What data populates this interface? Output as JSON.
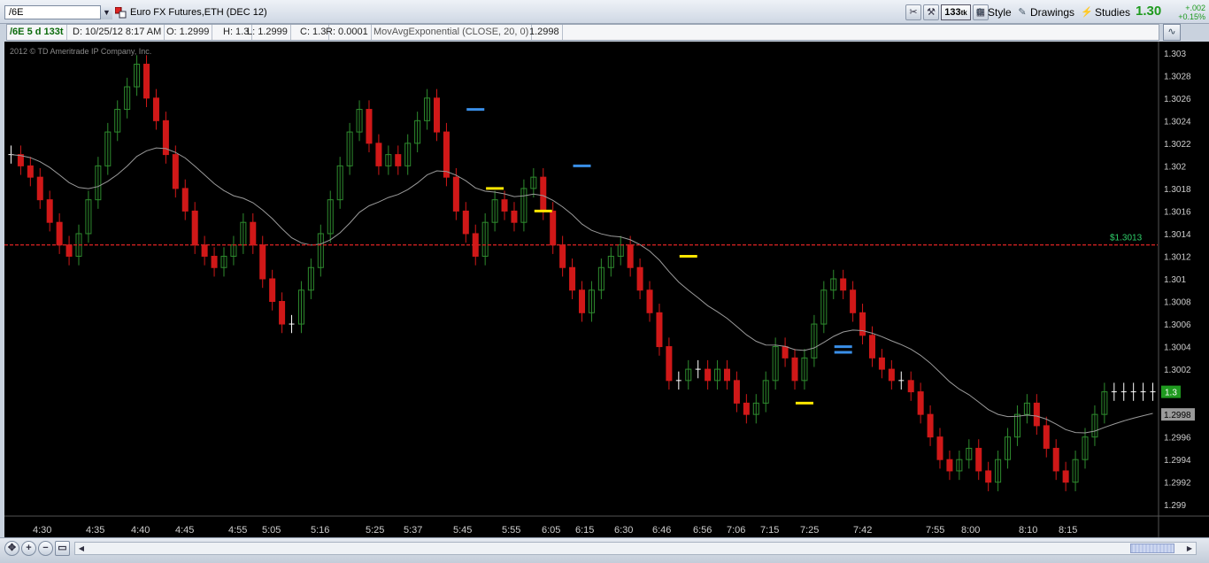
{
  "toolbar": {
    "symbol": "/6E",
    "instrument": "Euro FX Futures,ETH (DEC 12)",
    "tick_aggregation": "133",
    "tick_suffix": "tk",
    "style_label": "Style",
    "drawings_label": "Drawings",
    "studies_label": "Studies",
    "last_price": "1.30",
    "net_change": "+.002",
    "net_change_pct": "+0.15%"
  },
  "infobar": {
    "symbol_period": "/6E 5 d 133t",
    "date": "D: 10/25/12 8:17 AM",
    "open": "O: 1.2999",
    "high": "H: 1.3",
    "low": "L: 1.2999",
    "close": "C: 1.3",
    "range": "R: 0.0001",
    "study": "MovAvgExponential (CLOSE, 20, 0)",
    "study_value": "1.2998"
  },
  "chart": {
    "copyright": "2012 © TD Ameritrade IP Company, Inc.",
    "colors": {
      "background": "#000000",
      "up": "#2e8b2e",
      "down": "#d01818",
      "flat": "#ffffff",
      "ema": "#9a9a9a",
      "hline": "#cc2020",
      "hline_label": "#2fd06a",
      "price_marker": "#1f9a1f",
      "ema_marker": "#9a9a9a",
      "axis_text": "#cccccc"
    }
  },
  "chart_data": {
    "type": "candlestick",
    "ylim": [
      1.2989,
      1.3031
    ],
    "y_ticks": [
      "1.303",
      "1.3028",
      "1.3026",
      "1.3024",
      "1.3022",
      "1.302",
      "1.3018",
      "1.3016",
      "1.3014",
      "1.3012",
      "1.301",
      "1.3008",
      "1.3006",
      "1.3004",
      "1.3002",
      "1.3",
      "1.2998",
      "1.2996",
      "1.2994",
      "1.2992",
      "1.299"
    ],
    "x_labels": [
      "4:30",
      "4:35",
      "4:40",
      "4:45",
      "4:55",
      "5:05",
      "5:16",
      "5:25",
      "5:37",
      "5:45",
      "5:55",
      "6:05",
      "6:15",
      "6:30",
      "6:46",
      "6:56",
      "7:06",
      "7:15",
      "7:25",
      "7:42",
      "7:55",
      "8:00",
      "8:10",
      "8:15"
    ],
    "closes": [
      1.3021,
      1.302,
      1.3019,
      1.3017,
      1.3015,
      1.3013,
      1.3012,
      1.3014,
      1.3017,
      1.302,
      1.3023,
      1.3025,
      1.3027,
      1.3029,
      1.3026,
      1.3024,
      1.3021,
      1.3018,
      1.3016,
      1.3013,
      1.3012,
      1.3011,
      1.3012,
      1.3013,
      1.3015,
      1.3013,
      1.301,
      1.3008,
      1.3006,
      1.3006,
      1.3009,
      1.3011,
      1.3014,
      1.3017,
      1.302,
      1.3023,
      1.3025,
      1.3022,
      1.302,
      1.3021,
      1.302,
      1.3022,
      1.3024,
      1.3026,
      1.3023,
      1.3019,
      1.3016,
      1.3014,
      1.3012,
      1.3015,
      1.3017,
      1.3016,
      1.3015,
      1.3018,
      1.3019,
      1.3016,
      1.3013,
      1.3011,
      1.3009,
      1.3007,
      1.3009,
      1.3011,
      1.3012,
      1.3013,
      1.3011,
      1.3009,
      1.3007,
      1.3004,
      1.3001,
      1.3001,
      1.3002,
      1.3002,
      1.3001,
      1.3002,
      1.3001,
      1.2999,
      1.2998,
      1.2999,
      1.3001,
      1.3004,
      1.3003,
      1.3001,
      1.3003,
      1.3006,
      1.3009,
      1.301,
      1.3009,
      1.3007,
      1.3005,
      1.3003,
      1.3002,
      1.3001,
      1.3001,
      1.3,
      1.2998,
      1.2996,
      1.2994,
      1.2993,
      1.2994,
      1.2995,
      1.2993,
      1.2992,
      1.2994,
      1.2996,
      1.2998,
      1.2999,
      1.2997,
      1.2995,
      1.2993,
      1.2992,
      1.2994,
      1.2996,
      1.2998,
      1.3,
      1.3,
      1.3,
      1.3,
      1.3,
      1.3
    ],
    "ema_start": 1.3021,
    "ema_period": 20,
    "horizontal_line": {
      "value": 1.3013,
      "label": "$1.3013"
    },
    "price_label": "1.3",
    "price_value": 1.3,
    "ema_label": "1.2998",
    "ema_value": 1.2998,
    "trade_marks": [
      {
        "index": 48,
        "value": 1.3025,
        "color": "#3a8fe8"
      },
      {
        "index": 50,
        "value": 1.3018,
        "color": "#ffe600"
      },
      {
        "index": 55,
        "value": 1.3016,
        "color": "#ffe600"
      },
      {
        "index": 59,
        "value": 1.302,
        "color": "#3a8fe8"
      },
      {
        "index": 70,
        "value": 1.3012,
        "color": "#ffe600"
      },
      {
        "index": 82,
        "value": 1.2999,
        "color": "#ffe600"
      },
      {
        "index": 86,
        "value": 1.3004,
        "color": "#3a8fe8"
      },
      {
        "index": 86,
        "value": 1.30035,
        "color": "#3a8fe8"
      }
    ]
  }
}
